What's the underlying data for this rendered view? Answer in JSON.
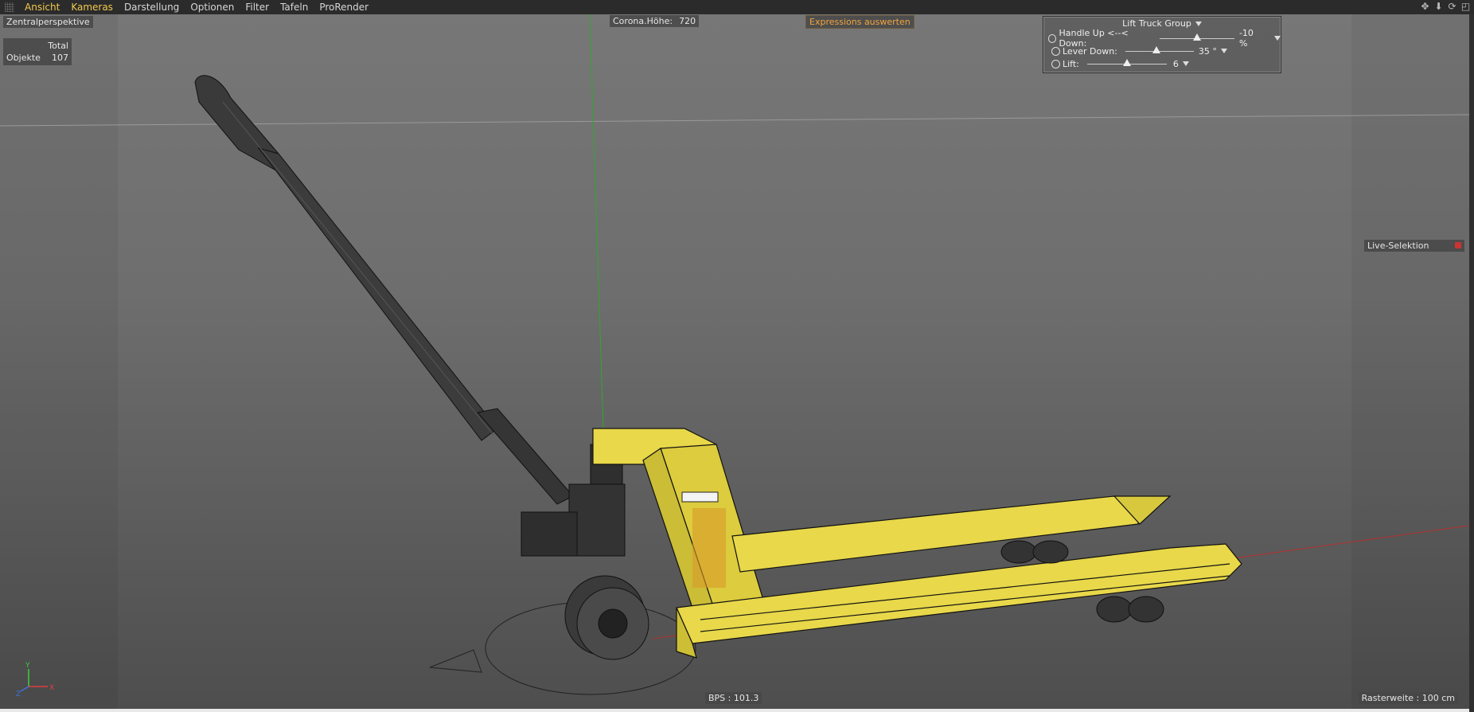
{
  "menu": [
    "Ansicht",
    "Kameras",
    "Darstellung",
    "Optionen",
    "Filter",
    "Tafeln",
    "ProRender"
  ],
  "active_menu": [
    "Ansicht",
    "Kameras"
  ],
  "window_icons": [
    "move-icon",
    "down-arrow-icon",
    "rotate-icon",
    "maximize-icon"
  ],
  "viewport": {
    "camera": "Zentralperspektive",
    "stats": {
      "header": "Total",
      "label": "Objekte",
      "value": "107"
    },
    "corona": {
      "label": "Corona.Höhe:",
      "value": "720"
    },
    "expressions_button": "Expressions auswerten",
    "live_selection": "Live-Selektion",
    "fps": "BPS : 101.3",
    "grid_spacing": "Rasterweite : 100 cm",
    "axis_labels": [
      "Y",
      "X",
      "Z"
    ]
  },
  "xpresso_panel": {
    "title": "Lift Truck Group",
    "controls": [
      {
        "label": "Handle Up <--< Down:",
        "value": "-10 %",
        "level": 0.5
      },
      {
        "label": "Lever Down:",
        "value": "35 °",
        "level": 0.45
      },
      {
        "label": "Lift:",
        "value": "6",
        "level": 0.5
      }
    ]
  },
  "colors": {
    "accent": "#f2c94c",
    "model_yellow": "#e8d84a",
    "wire_dark": "#2a2a2a",
    "expr_orange": "#f2a43c"
  }
}
